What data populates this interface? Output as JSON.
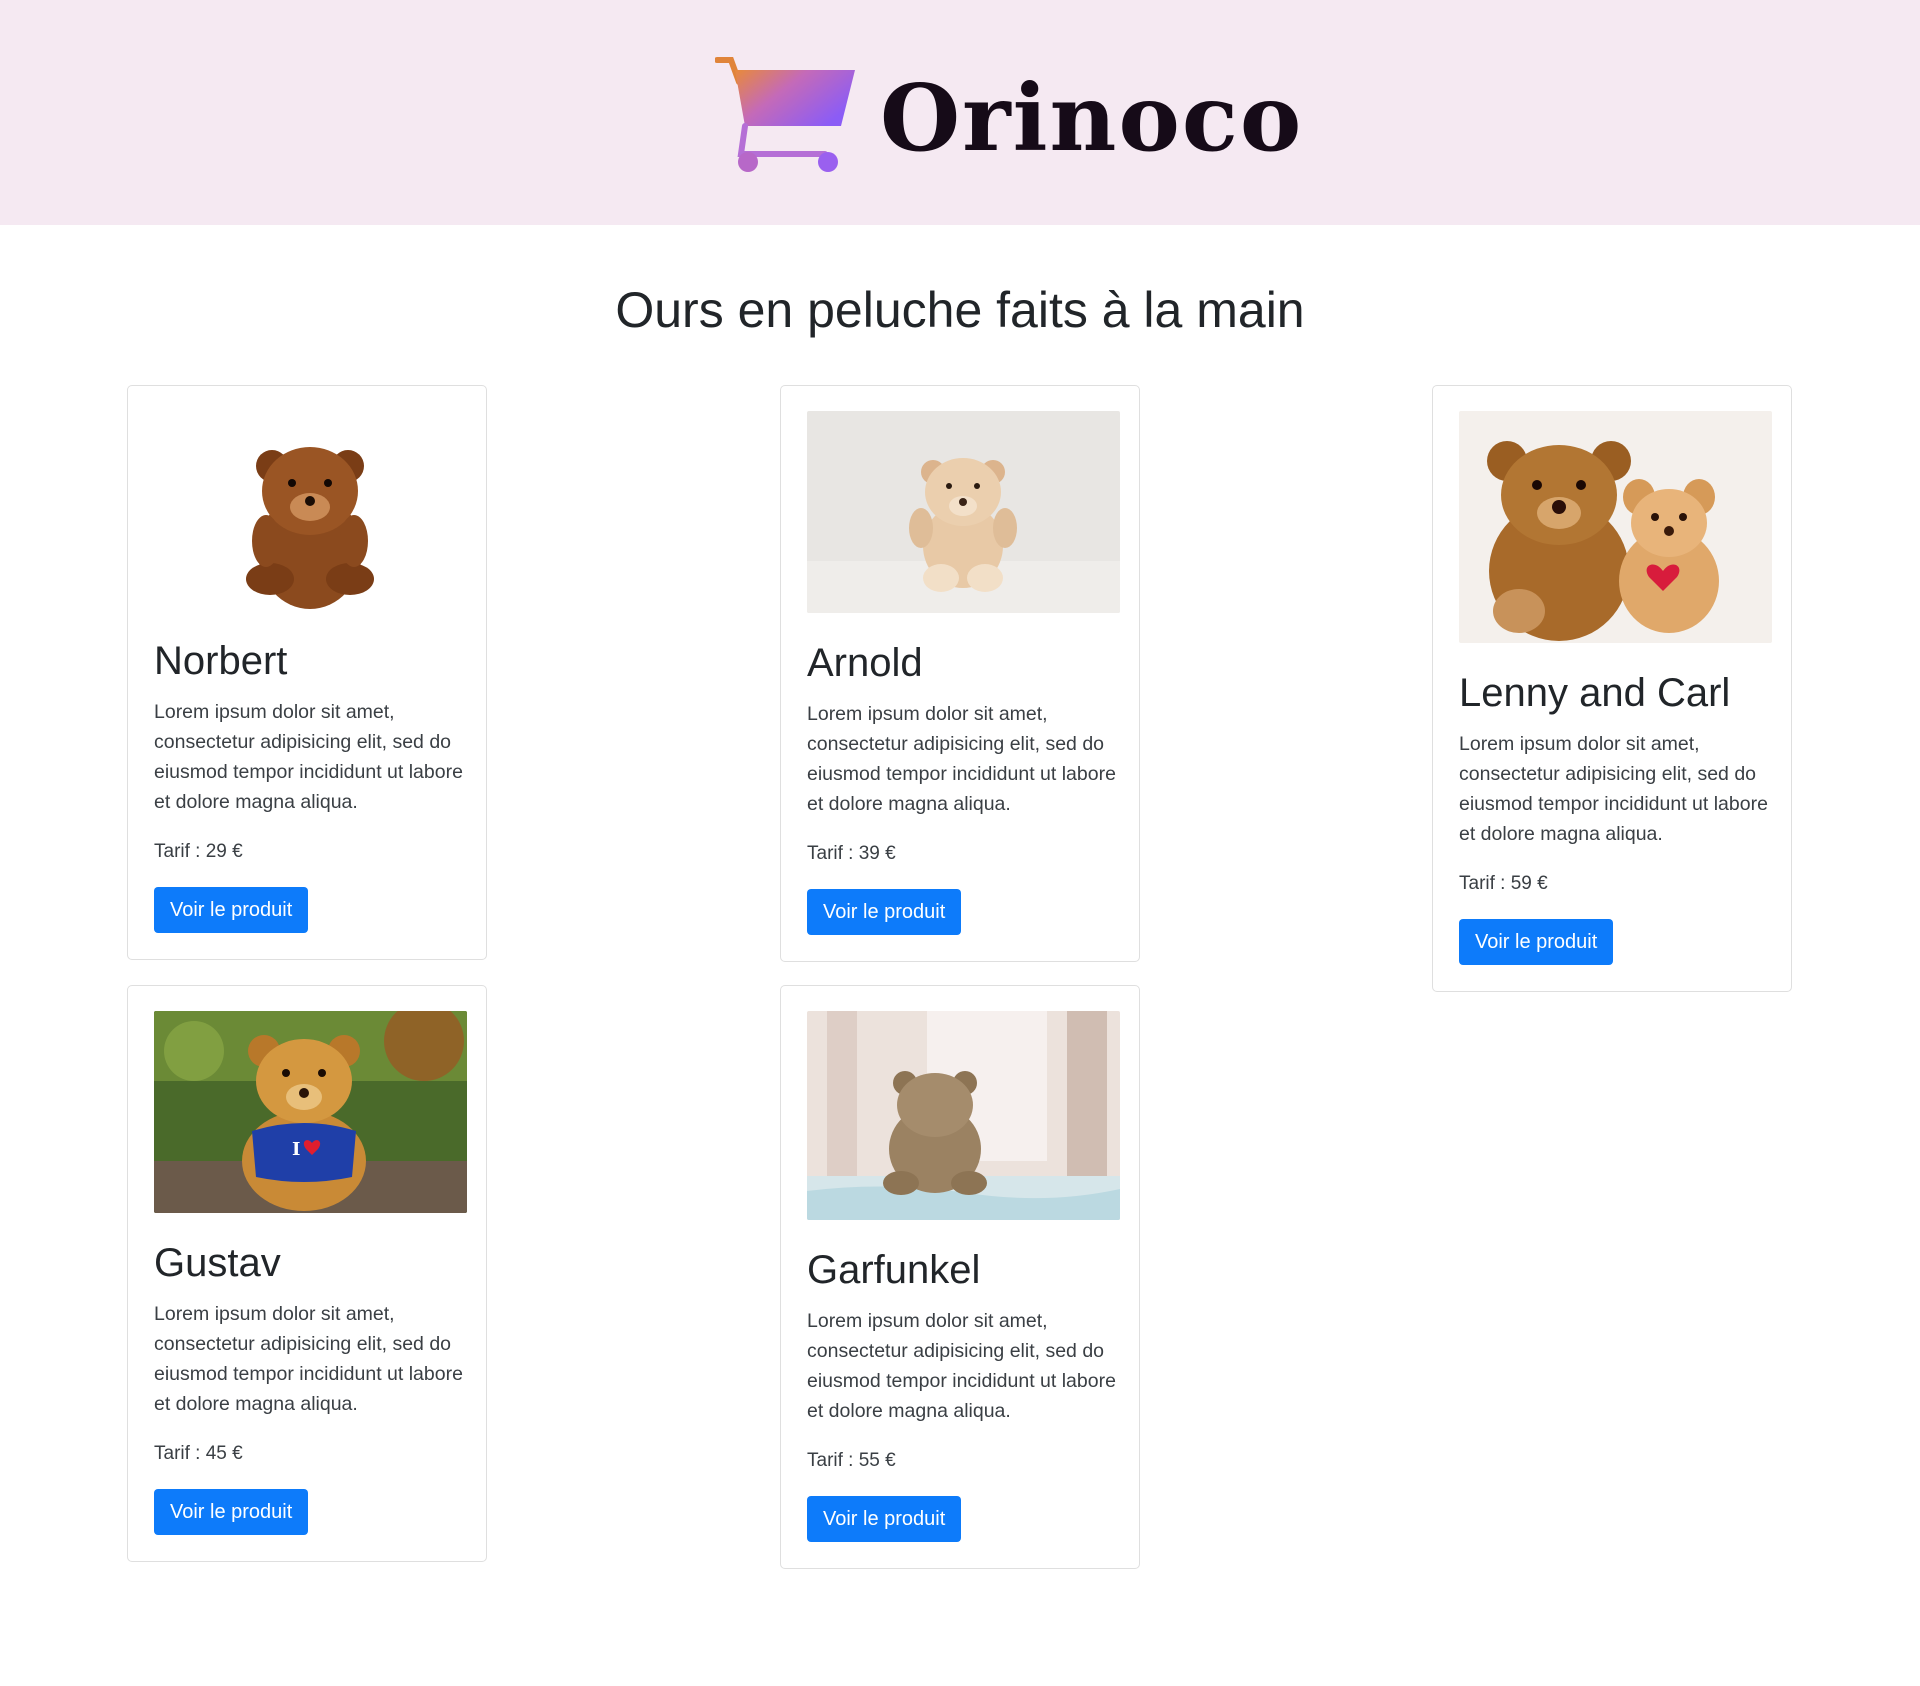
{
  "header": {
    "logo_text": "Orinoco",
    "logo_icon": "shopping-cart-icon"
  },
  "page": {
    "title": "Ours en peluche faits à la main"
  },
  "price_label": "Tarif :",
  "currency": "€",
  "button_label": "Voir le produit",
  "products": [
    {
      "name": "Norbert",
      "description": "Lorem ipsum dolor sit amet, consectetur adipisicing elit, sed do eiusmod tempor incididunt ut labore et dolore magna aliqua.",
      "price": "29",
      "image_icon": "teddy-bear-brown-photo"
    },
    {
      "name": "Arnold",
      "description": "Lorem ipsum dolor sit amet, consectetur adipisicing elit, sed do eiusmod tempor incididunt ut labore et dolore magna aliqua.",
      "price": "39",
      "image_icon": "teddy-bear-beige-photo"
    },
    {
      "name": "Lenny and Carl",
      "description": "Lorem ipsum dolor sit amet, consectetur adipisicing elit, sed do eiusmod tempor incididunt ut labore et dolore magna aliqua.",
      "price": "59",
      "image_icon": "two-teddy-bears-photo"
    },
    {
      "name": "Gustav",
      "description": "Lorem ipsum dolor sit amet, consectetur adipisicing elit, sed do eiusmod tempor incididunt ut labore et dolore magna aliqua.",
      "price": "45",
      "image_icon": "teddy-bear-blue-shirt-photo"
    },
    {
      "name": "Garfunkel",
      "description": "Lorem ipsum dolor sit amet, consectetur adipisicing elit, sed do eiusmod tempor incididunt ut labore et dolore magna aliqua.",
      "price": "55",
      "image_icon": "teddy-bear-window-photo"
    }
  ],
  "colors": {
    "header_bg": "#f5e9f2",
    "button_bg": "#0d7bfa",
    "button_text": "#ffffff",
    "logo_text": "#160b18",
    "cart_gradient_start": "#e88a3a",
    "cart_gradient_end": "#8b5cf6"
  }
}
